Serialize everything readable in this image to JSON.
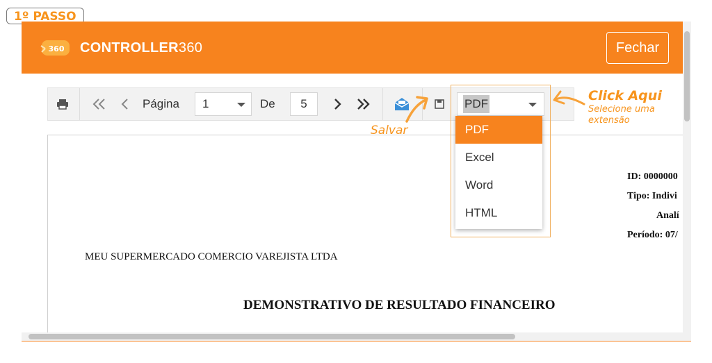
{
  "step_badge": "1º PASSO",
  "header": {
    "logo_badge_text": "360",
    "logo_main": "CONTROLLER",
    "logo_num": "360",
    "close_label": "Fechar",
    "brand_color": "#f7831e"
  },
  "toolbar": {
    "page_label": "Página",
    "page_value": "1",
    "of_label": "De",
    "total_pages": "5",
    "format_value": "PDF",
    "icons": [
      "printer-icon",
      "first-page-icon",
      "prev-page-icon",
      "next-page-icon",
      "last-page-icon",
      "email-icon",
      "save-icon"
    ]
  },
  "dropdown": {
    "options": [
      "PDF",
      "Excel",
      "Word",
      "HTML"
    ],
    "selected": "PDF"
  },
  "annotations": {
    "click_here": "Click Aqui",
    "select_line1": "Selecione uma",
    "select_line2": "extensão",
    "save": "Salvar"
  },
  "document": {
    "id_label": "ID: 0000000",
    "type_label": "Tipo: Indivi",
    "analytic_label": "Analí",
    "period_label": "Período: 07/",
    "company": "MEU SUPERMERCADO COMERCIO VAREJISTA LTDA",
    "title": "DEMONSTRATIVO DE RESULTADO FINANCEIRO"
  }
}
